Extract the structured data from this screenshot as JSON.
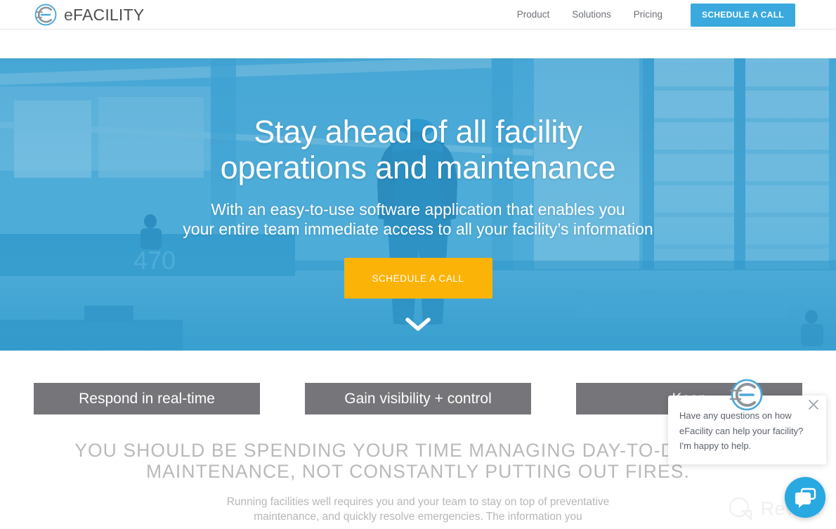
{
  "brand": {
    "name_prefix": "e",
    "name_main": "FACILITY",
    "logo_icon": "efacility-circle-logo-icon",
    "logo_ring_color": "#4aa8d8",
    "logo_inner_color": "#8f9499"
  },
  "nav": {
    "links": [
      {
        "label": "Product"
      },
      {
        "label": "Solutions"
      },
      {
        "label": "Pricing"
      }
    ],
    "cta_label": "SCHEDULE A CALL",
    "cta_color": "#3aa9dd"
  },
  "hero": {
    "title_line1": "Stay ahead of all facility",
    "title_line2": "operations and maintenance",
    "sub_line1": "With an easy-to-use software application that enables you",
    "sub_line2": "your entire team immediate access to all your facility’s information",
    "cta_label": "SCHEDULE A CALL",
    "cta_color": "#fbb307",
    "scroll_icon": "chevron-down-icon",
    "overlay_color": "#2e9bcd",
    "background_image": "industrial-facility-worker-photo"
  },
  "features": [
    {
      "label": "Respond in real-time"
    },
    {
      "label": "Gain visibility + control"
    },
    {
      "label": "Keep"
    }
  ],
  "feature_bar_color": "#76767a",
  "section": {
    "heading_line1": "YOU SHOULD BE SPENDING YOUR TIME MANAGING DAY-TO-DAY OPER",
    "heading_line2": "MAINTENANCE, NOT CONSTANTLY PUTTING OUT FIRES.",
    "body_line1": "Running facilities well requires you and your team to stay on top of preventative",
    "body_line2": "maintenance, and quickly resolve emergencies. The information you"
  },
  "chat": {
    "message_line1": "Have any questions on how",
    "message_line2": "eFacility can help your facility?",
    "message_line3": "I'm happy to help.",
    "avatar_icon": "efacility-circle-logo-icon",
    "close_icon": "close-icon",
    "launcher_icon": "chat-bubble-icon",
    "launcher_color": "#29a9e1"
  },
  "watermark": {
    "text": "Revain",
    "icon": "revain-logo-icon"
  }
}
